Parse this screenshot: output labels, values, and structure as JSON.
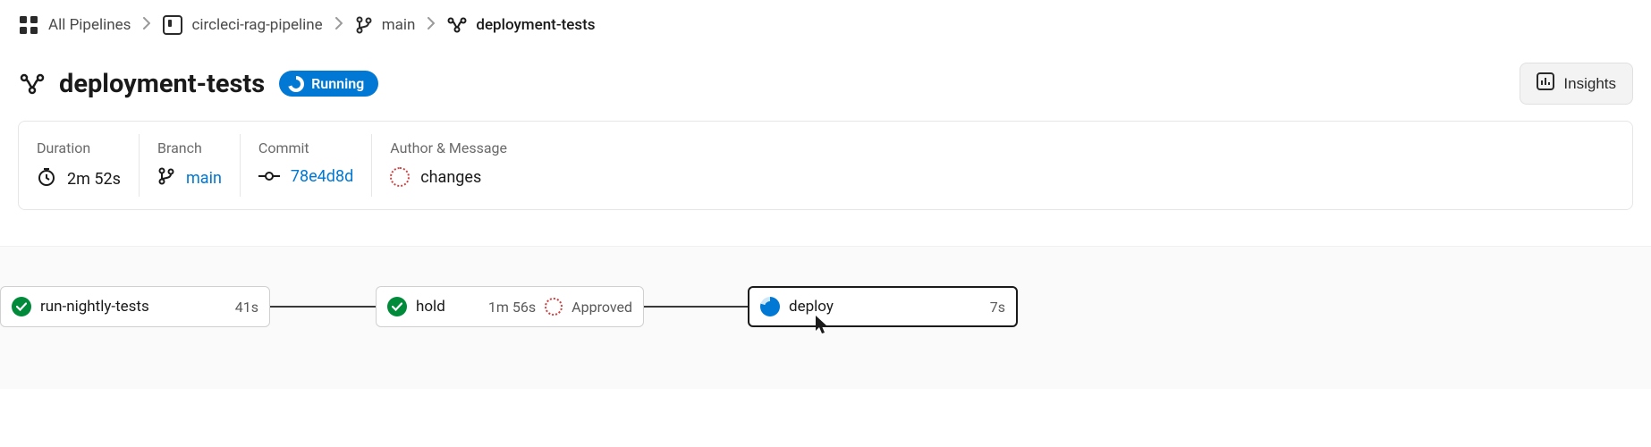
{
  "breadcrumb": {
    "root": "All Pipelines",
    "project": "circleci-rag-pipeline",
    "branch": "main",
    "workflow": "deployment-tests"
  },
  "title": {
    "name": "deployment-tests",
    "status_label": "Running"
  },
  "insights_label": "Insights",
  "info": {
    "duration_label": "Duration",
    "duration_value": "2m 52s",
    "branch_label": "Branch",
    "branch_value": "main",
    "commit_label": "Commit",
    "commit_value": "78e4d8d",
    "author_label": "Author & Message",
    "author_message": "changes"
  },
  "jobs": {
    "j1": {
      "name": "run-nightly-tests",
      "duration": "41s"
    },
    "j2": {
      "name": "hold",
      "duration": "1m 56s",
      "approved": "Approved"
    },
    "j3": {
      "name": "deploy",
      "duration": "7s"
    }
  }
}
